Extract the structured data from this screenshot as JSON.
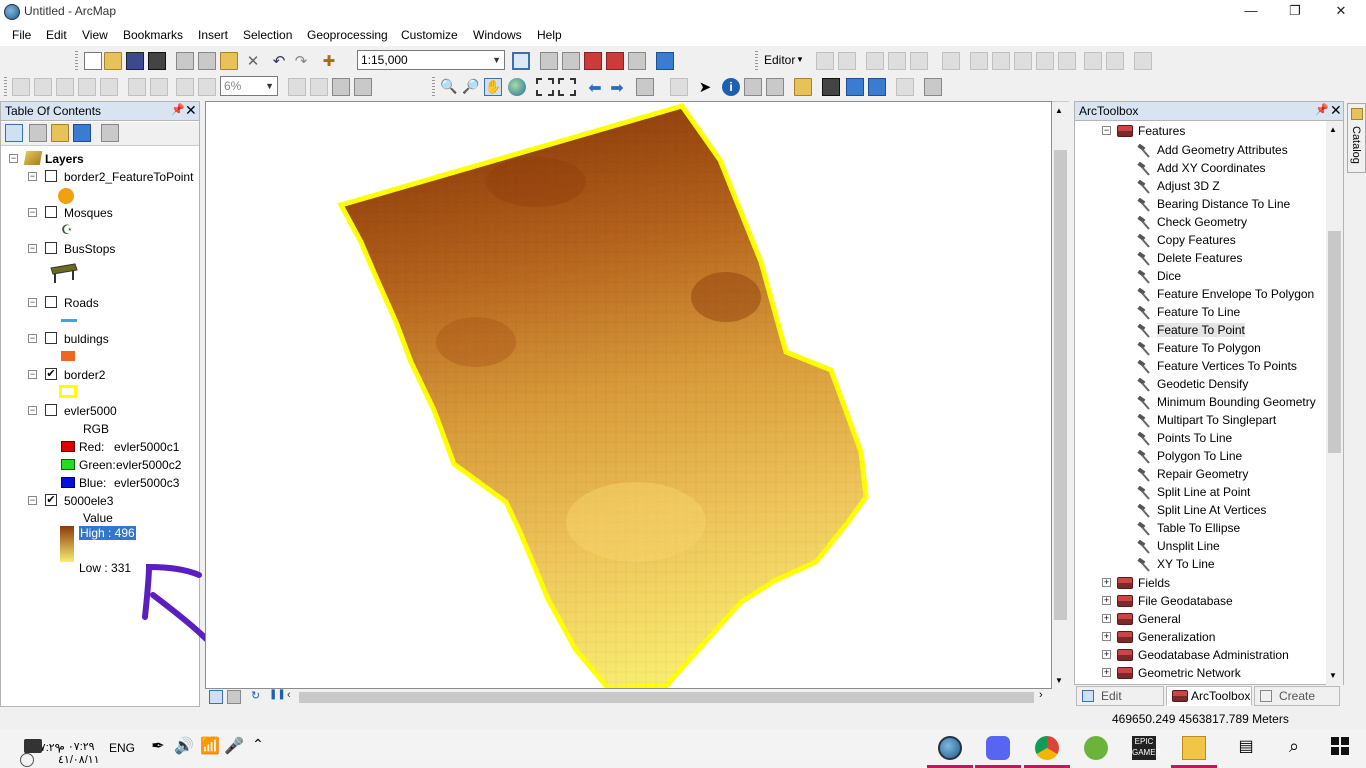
{
  "window": {
    "title": "Untitled - ArcMap",
    "minimize": "—",
    "restore": "❐",
    "close": "✕"
  },
  "menu": [
    "File",
    "Edit",
    "View",
    "Bookmarks",
    "Insert",
    "Selection",
    "Geoprocessing",
    "Customize",
    "Windows",
    "Help"
  ],
  "toolbar": {
    "scale": "1:15,000",
    "editor_label": "Editor",
    "zoom_percent": "6%"
  },
  "toc": {
    "title": "Table Of Contents",
    "root": "Layers",
    "layers": [
      {
        "name": "border2_FeatureToPoint",
        "checked": false
      },
      {
        "name": "Mosques",
        "checked": false
      },
      {
        "name": "BusStops",
        "checked": false
      },
      {
        "name": "Roads",
        "checked": false
      },
      {
        "name": "buldings",
        "checked": false
      },
      {
        "name": "border2",
        "checked": true
      },
      {
        "name": "evler5000",
        "checked": false
      },
      {
        "name": "5000ele3",
        "checked": true
      }
    ],
    "rgb": {
      "label": "RGB",
      "red": "Red:",
      "red_val": "evler5000c1",
      "green": "Green:",
      "green_val": "evler5000c2",
      "blue": "Blue:",
      "blue_val": "evler5000c3"
    },
    "value": {
      "label": "Value",
      "high": "High : 496",
      "low": "Low : 331"
    },
    "check_mark": "✔"
  },
  "colors": {
    "ramp_high": "#8b3a0a",
    "ramp_low": "#f9ec70",
    "border": "#ffff00",
    "annotation": "#5b1fbf",
    "mosque": "#2f5f2f",
    "point": "#f0a010",
    "roads": "#33aadd",
    "buildings": "#ee6622"
  },
  "toolbox": {
    "title": "ArcToolbox",
    "group": "Features",
    "tools": [
      "Add Geometry Attributes",
      "Add XY Coordinates",
      "Adjust 3D Z",
      "Bearing Distance To Line",
      "Check Geometry",
      "Copy Features",
      "Delete Features",
      "Dice",
      "Feature Envelope To Polygon",
      "Feature To Line",
      "Feature To Point",
      "Feature To Polygon",
      "Feature Vertices To Points",
      "Geodetic Densify",
      "Minimum Bounding Geometry",
      "Multipart To Singlepart",
      "Points To Line",
      "Polygon To Line",
      "Repair Geometry",
      "Split Line at Point",
      "Split Line At Vertices",
      "Table To Ellipse",
      "Unsplit Line",
      "XY To Line"
    ],
    "selected_tool": "Feature To Point",
    "other_toolsets": [
      "Fields",
      "File Geodatabase",
      "General",
      "Generalization",
      "Geodatabase Administration",
      "Geometric Network"
    ],
    "tabs": [
      "Edit Sketc...",
      "ArcToolbox",
      "Create Fe..."
    ],
    "catalog": "Catalog"
  },
  "status": {
    "coords": "469650.249  4563817.789 Meters"
  },
  "taskbar": {
    "time": "٠٧:٢٩ م",
    "date": "٤١/٠٨/١١",
    "lang": "ENG"
  }
}
